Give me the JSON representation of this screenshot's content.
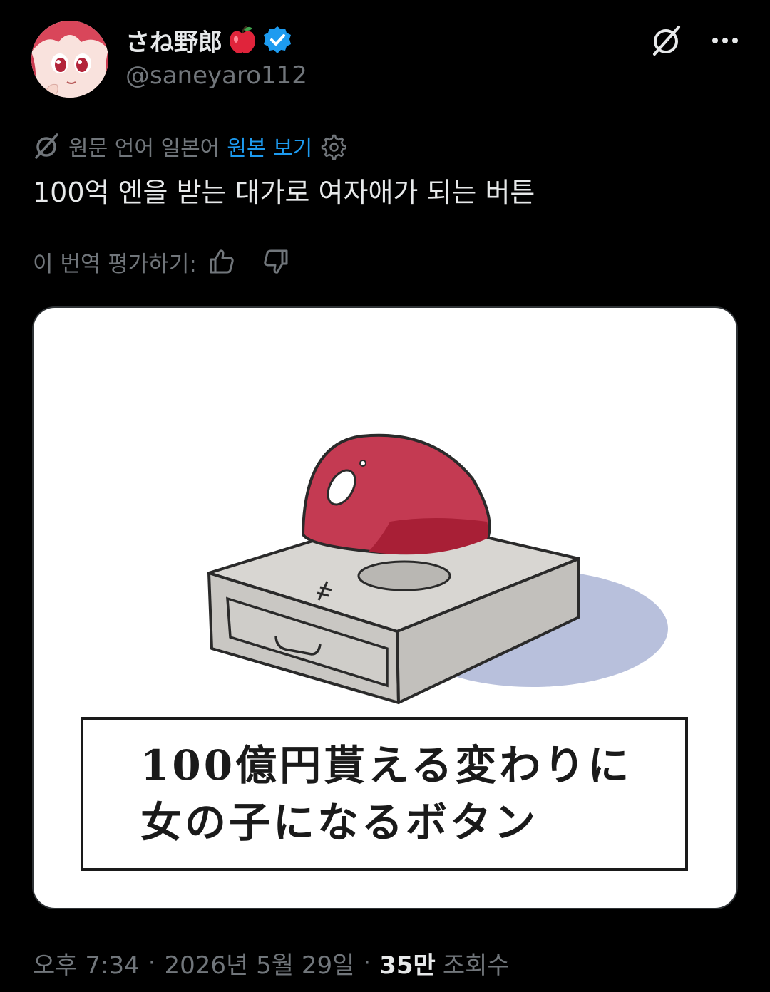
{
  "header": {
    "display_name": "さね野郎",
    "name_emoji": "🍎",
    "verified": true,
    "handle": "@saneyaro112"
  },
  "translation": {
    "source_label": "원문 언어 일본어",
    "view_original": "원본 보기"
  },
  "tweet": {
    "text": "100억 엔을 받는 대가로 여자애가 되는 버튼"
  },
  "rating": {
    "label": "이 번역 평가하기:"
  },
  "media": {
    "caption_line1": "100億円貰える変わりに",
    "caption_line2": "女の子になるボタン"
  },
  "meta": {
    "time": "오후 7:34",
    "date": "2026년 5월 29일",
    "views_count": "35만",
    "views_label": "조회수"
  },
  "colors": {
    "background": "#000000",
    "text": "#e7e9ea",
    "muted": "#71767b",
    "link": "#1d9bf0",
    "verified": "#1d9bf0"
  }
}
